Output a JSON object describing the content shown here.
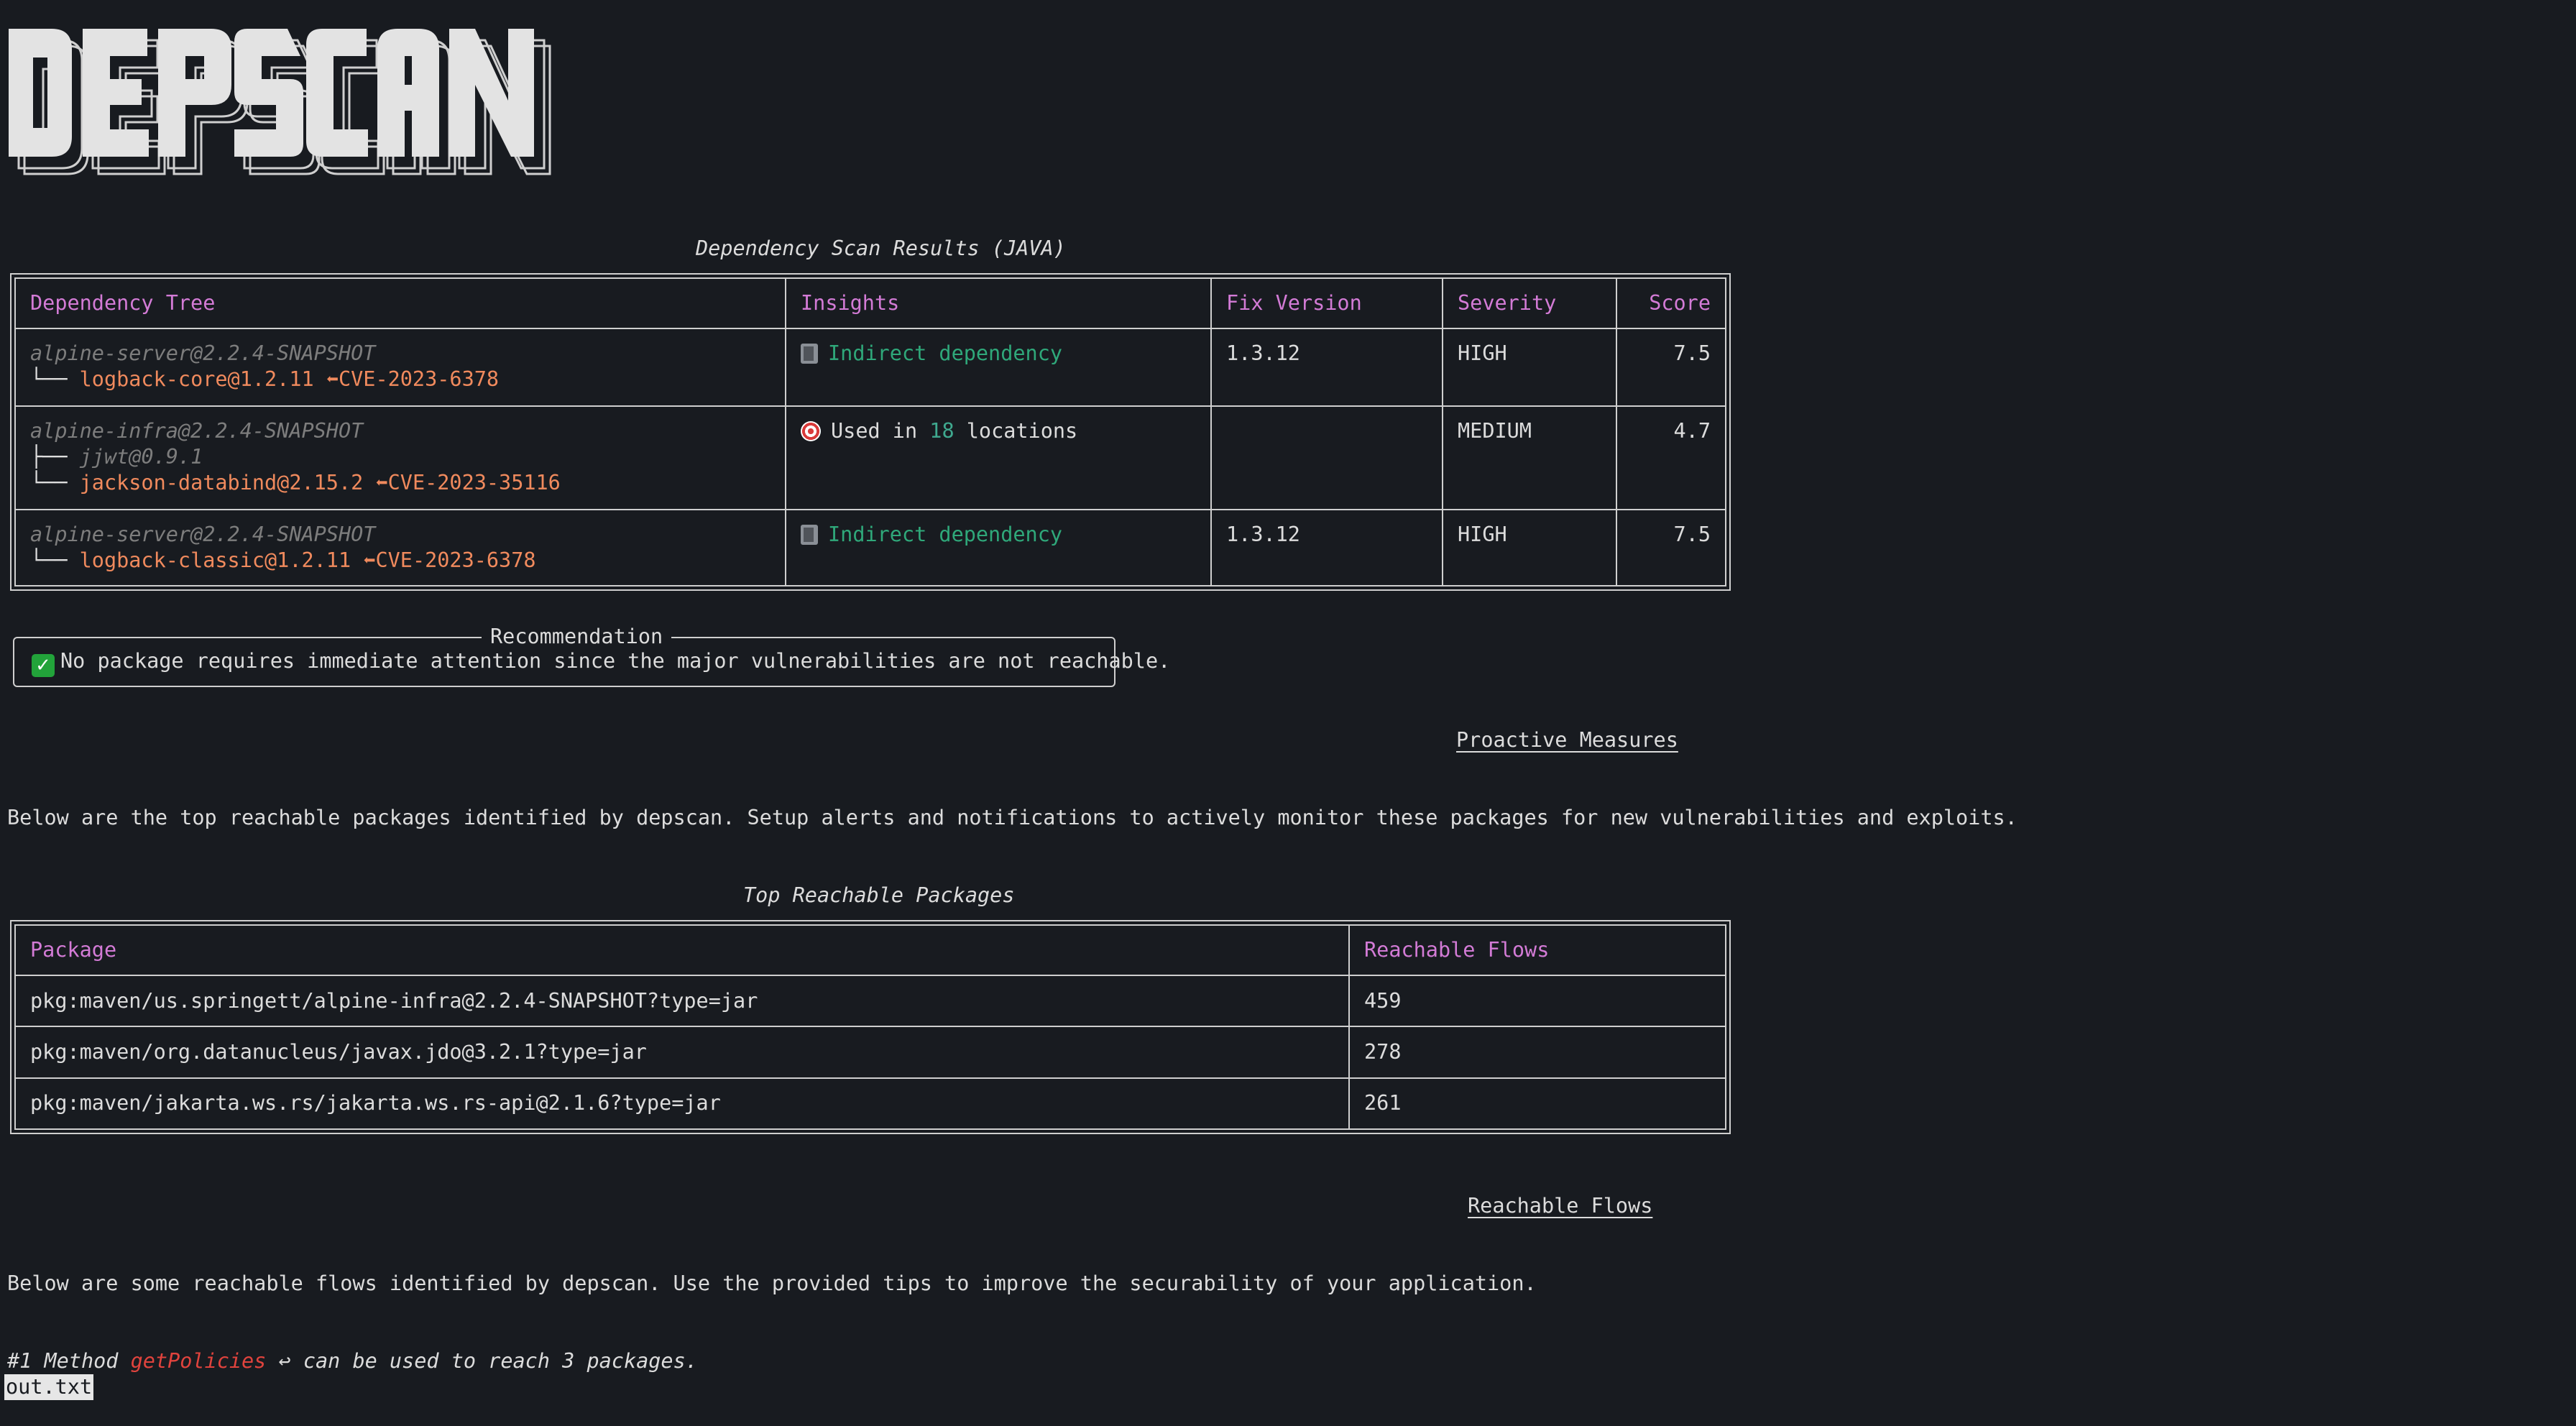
{
  "logo_text": "DEPSCAN",
  "scan_title": "Dependency Scan Results (JAVA)",
  "dep_table": {
    "headers": [
      "Dependency Tree",
      "Insights",
      "Fix Version",
      "Severity",
      "Score"
    ],
    "rows": [
      {
        "parent": "alpine-server@2.2.4-SNAPSHOT",
        "tree": [
          {
            "prefix": "└── ",
            "name": "logback-core@1.2.11",
            "cve": "⬅CVE-2023-6378",
            "vulnerable": true
          }
        ],
        "insight_icon": "book-icon",
        "insight": "Indirect dependency",
        "fix_version": "1.3.12",
        "severity": "HIGH",
        "score": "7.5"
      },
      {
        "parent": "alpine-infra@2.2.4-SNAPSHOT",
        "tree": [
          {
            "prefix": "├── ",
            "name": "jjwt@0.9.1",
            "cve": "",
            "vulnerable": false
          },
          {
            "prefix": "└── ",
            "name": "jackson-databind@2.15.2",
            "cve": "⬅CVE-2023-35116",
            "vulnerable": true
          }
        ],
        "insight_icon": "target-icon",
        "insight_prefix": "Used in ",
        "insight_count": "18",
        "insight_suffix": " locations",
        "fix_version": "",
        "severity": "MEDIUM",
        "score": "4.7"
      },
      {
        "parent": "alpine-server@2.2.4-SNAPSHOT",
        "tree": [
          {
            "prefix": "└── ",
            "name": "logback-classic@1.2.11",
            "cve": "⬅CVE-2023-6378",
            "vulnerable": true
          }
        ],
        "insight_icon": "book-icon",
        "insight": "Indirect dependency",
        "fix_version": "1.3.12",
        "severity": "HIGH",
        "score": "7.5"
      }
    ]
  },
  "recommendation": {
    "title": "Recommendation",
    "text": "No package requires immediate attention since the major vulnerabilities are not reachable."
  },
  "proactive": {
    "heading": "Proactive Measures",
    "text": "Below are the top reachable packages identified by depscan. Setup alerts and notifications to actively monitor these packages for new vulnerabilities and exploits."
  },
  "reachable_title": "Top Reachable Packages",
  "reach_table": {
    "headers": [
      "Package",
      "Reachable Flows"
    ],
    "rows": [
      {
        "package": "pkg:maven/us.springett/alpine-infra@2.2.4-SNAPSHOT?type=jar",
        "flows": "459"
      },
      {
        "package": "pkg:maven/org.datanucleus/javax.jdo@3.2.1?type=jar",
        "flows": "278"
      },
      {
        "package": "pkg:maven/jakarta.ws.rs/jakarta.ws.rs-api@2.1.6?type=jar",
        "flows": "261"
      }
    ]
  },
  "flows": {
    "heading": "Reachable Flows",
    "text": "Below are some reachable flows identified by depscan. Use the provided tips to improve the securability of your application.",
    "method_prefix": "#1 Method ",
    "method_name": "getPolicies",
    "method_suffix": " ↩ can be used to reach 3 packages."
  },
  "prompt_text": "out.txt"
}
